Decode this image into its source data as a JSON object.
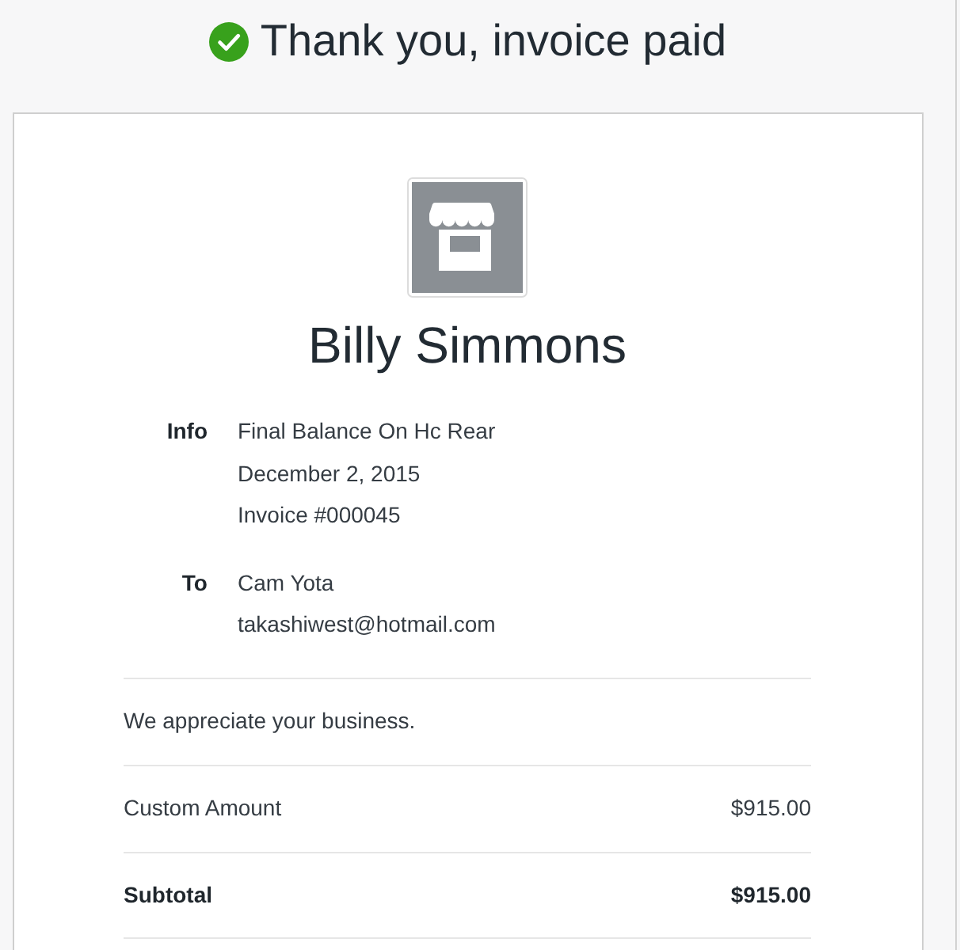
{
  "header": {
    "title": "Thank you, invoice paid"
  },
  "invoice": {
    "merchant_name": "Billy Simmons",
    "details": [
      {
        "label": "Info",
        "lines": [
          "Final Balance On Hc Rear",
          "December 2, 2015",
          "Invoice #000045"
        ]
      },
      {
        "label": "To",
        "lines": [
          "Cam Yota",
          "takashiwest@hotmail.com"
        ]
      }
    ],
    "message": "We appreciate your business.",
    "line_items": [
      {
        "kind": "item",
        "label": "Custom Amount",
        "amount": "$915.00"
      },
      {
        "kind": "subtotal",
        "label": "Subtotal",
        "amount": "$915.00"
      }
    ]
  }
}
